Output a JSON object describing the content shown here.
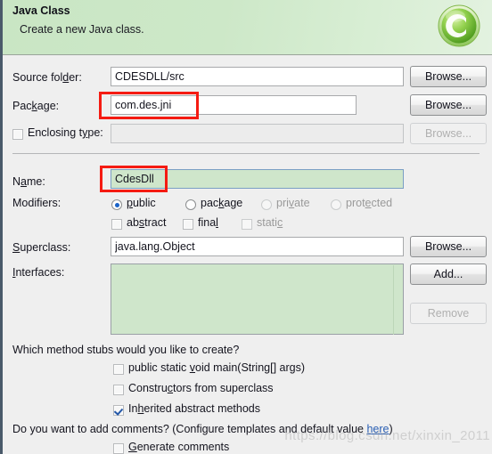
{
  "header": {
    "title": "Java Class",
    "subtitle": "Create a new Java class.",
    "icon": "java-class-green-c-icon"
  },
  "form": {
    "source_folder": {
      "label": "Source folder:",
      "value": "CDESDLL/src",
      "button": "Browse..."
    },
    "package": {
      "label": "Package:",
      "value": "com.des.jni",
      "placeholder": "",
      "button": "Browse..."
    },
    "enclosing_type": {
      "label": "Enclosing type:",
      "value": "",
      "checked": false,
      "button": "Browse...",
      "enabled": false
    },
    "name": {
      "label": "Name:",
      "value": "CdesDll"
    },
    "modifiers": {
      "label": "Modifiers:",
      "radios": [
        {
          "label": "public",
          "selected": true,
          "enabled": true
        },
        {
          "label": "package",
          "selected": false,
          "enabled": true
        },
        {
          "label": "private",
          "selected": false,
          "enabled": false
        },
        {
          "label": "protected",
          "selected": false,
          "enabled": false
        }
      ],
      "checkboxes": [
        {
          "label": "abstract",
          "checked": false,
          "enabled": true
        },
        {
          "label": "final",
          "checked": false,
          "enabled": true
        },
        {
          "label": "static",
          "checked": false,
          "enabled": false
        }
      ]
    },
    "superclass": {
      "label": "Superclass:",
      "value": "java.lang.Object",
      "button": "Browse..."
    },
    "interfaces": {
      "label": "Interfaces:",
      "items": [],
      "add_button": "Add...",
      "remove_button": "Remove"
    }
  },
  "stubs": {
    "question": "Which method stubs would you like to create?",
    "options": [
      {
        "label": "public static void main(String[] args)",
        "checked": false
      },
      {
        "label": "Constructors from superclass",
        "checked": false
      },
      {
        "label": "Inherited abstract methods",
        "checked": true
      }
    ]
  },
  "comments": {
    "question_prefix": "Do you want to add comments? (Configure templates and default value ",
    "link": "here",
    "question_suffix": ")",
    "option": {
      "label": "Generate comments",
      "checked": false
    }
  },
  "watermark": "https://blog.csdn.net/xinxin_2011",
  "annotations": {
    "package_highlight": "red-rectangle-package",
    "name_highlight": "red-rectangle-name"
  },
  "colors": {
    "header_green": "#cde8c8",
    "field_green": "#cfe6cb",
    "annotation_red": "#f51b12",
    "link_blue": "#2a5fb4"
  }
}
